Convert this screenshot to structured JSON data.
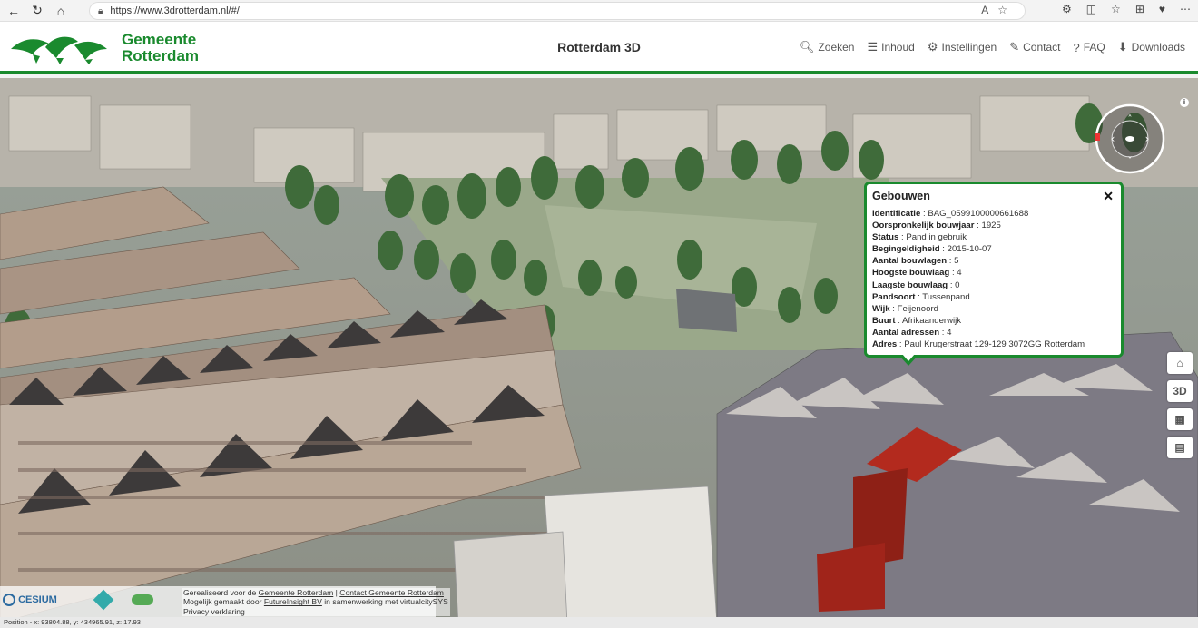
{
  "browser": {
    "url": "https://www.3drotterdam.nl/#/"
  },
  "header": {
    "brand_line1": "Gemeente",
    "brand_line2": "Rotterdam",
    "app_title": "Rotterdam 3D",
    "menu": [
      {
        "label": "Zoeken",
        "icon": "search-icon"
      },
      {
        "label": "Inhoud",
        "icon": "list-icon"
      },
      {
        "label": "Instellingen",
        "icon": "gear-icon"
      },
      {
        "label": "Contact",
        "icon": "edit-icon"
      },
      {
        "label": "FAQ",
        "icon": "question-icon"
      },
      {
        "label": "Downloads",
        "icon": "download-icon"
      }
    ]
  },
  "popup": {
    "title": "Gebouwen",
    "rows": [
      {
        "key": "Identificatie",
        "value": "BAG_0599100000661688"
      },
      {
        "key": "Oorspronkelijk bouwjaar",
        "value": "1925"
      },
      {
        "key": "Status",
        "value": "Pand in gebruik"
      },
      {
        "key": "Begingeldigheid",
        "value": "2015-10-07"
      },
      {
        "key": "Aantal bouwlagen",
        "value": "5"
      },
      {
        "key": "Hoogste bouwlaag",
        "value": "4"
      },
      {
        "key": "Laagste bouwlaag",
        "value": "0"
      },
      {
        "key": "Pandsoort",
        "value": "Tussenpand"
      },
      {
        "key": "Wijk",
        "value": "Feijenoord"
      },
      {
        "key": "Buurt",
        "value": "Afrikaanderwijk"
      },
      {
        "key": "Aantal adressen",
        "value": "4"
      },
      {
        "key": "Adres",
        "value": "Paul Krugerstraat 129-129 3072GG Rotterdam"
      }
    ]
  },
  "side_tools": [
    {
      "name": "home",
      "label": "⌂"
    },
    {
      "name": "3d",
      "label": "3D"
    },
    {
      "name": "grid",
      "label": "▦"
    },
    {
      "name": "map",
      "label": "▤"
    }
  ],
  "credits": {
    "cesium": "CESIUM",
    "line1_prefix": "Gerealiseerd voor de ",
    "line1_link1": "Gemeente Rotterdam",
    "line1_sep": " | ",
    "line1_link2": "Contact Gemeente Rotterdam",
    "line2_prefix": "Mogelijk gemaakt door ",
    "line2_link": "FutureInsight BV",
    "line2_suffix": " in samenwerking met virtualcitySYS",
    "line3": "Privacy verklaring"
  },
  "status": {
    "position": "Position - x: 93804.88, y: 434965.91, z: 17.93"
  },
  "colors": {
    "brand_green": "#1a8a2e",
    "selected_building": "#b32a1e"
  }
}
